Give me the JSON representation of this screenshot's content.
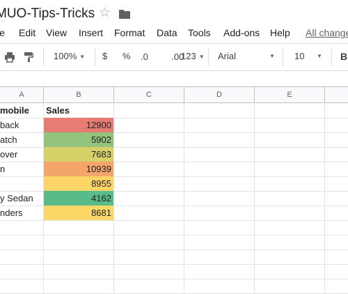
{
  "document": {
    "title": "MUO-Tips-Tricks"
  },
  "menu": {
    "items": [
      "le",
      "Edit",
      "View",
      "Insert",
      "Format",
      "Data",
      "Tools",
      "Add-ons",
      "Help"
    ],
    "status": "All change"
  },
  "toolbar": {
    "zoom": "100%",
    "currency": "$",
    "percent": "%",
    "decrease_decimal": ".0",
    "increase_decimal": ".00",
    "more_formats": "123",
    "font": "Arial",
    "font_size": "10",
    "bold": "B"
  },
  "sheet": {
    "columns": [
      "A",
      "B",
      "C",
      "D",
      "E"
    ],
    "rows": [
      {
        "a": "mobile",
        "b": "Sales",
        "header": true
      },
      {
        "a": "back",
        "b": "12900",
        "color": "#e67c73"
      },
      {
        "a": "atch",
        "b": "5902",
        "color": "#93c47d"
      },
      {
        "a": "over",
        "b": "7683",
        "color": "#d6d168"
      },
      {
        "a": "n",
        "b": "10939",
        "color": "#f4a56c"
      },
      {
        "a": "",
        "b": "8955",
        "color": "#fdd567"
      },
      {
        "a": "y Sedan",
        "b": "4162",
        "color": "#57bb8a"
      },
      {
        "a": "nders",
        "b": "8681",
        "color": "#fcd868"
      },
      {
        "a": "",
        "b": ""
      },
      {
        "a": "",
        "b": ""
      },
      {
        "a": "",
        "b": ""
      },
      {
        "a": "",
        "b": ""
      },
      {
        "a": "",
        "b": ""
      }
    ]
  }
}
